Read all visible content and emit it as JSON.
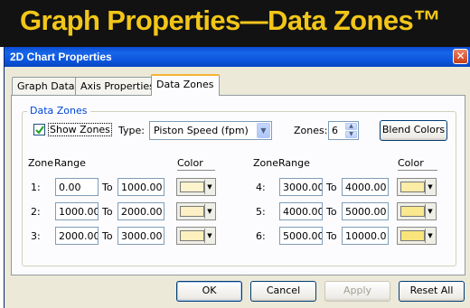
{
  "banner": {
    "title": "Graph Properties—Data Zones™"
  },
  "window": {
    "title": "2D Chart Properties",
    "close_icon": "close-icon"
  },
  "tabs": [
    {
      "label": "Graph Data"
    },
    {
      "label": "Axis Properties"
    },
    {
      "label": "Data Zones",
      "active": true
    }
  ],
  "group": {
    "legend": "Data Zones",
    "show_zones_label": "Show Zones",
    "show_zones_checked": true,
    "type_label": "Type:",
    "type_value": "Piston Speed (fpm)",
    "zones_label": "Zones:",
    "zones_value": "6",
    "blend_colors_label": "Blend Colors"
  },
  "columns": {
    "zone": "Zone",
    "range": "Range",
    "color": "Color",
    "to": "To"
  },
  "zones": [
    {
      "label": "1:",
      "from": "0.00",
      "to": "1000.00",
      "color": "#fdf3cd"
    },
    {
      "label": "2:",
      "from": "1000.00",
      "to": "2000.00",
      "color": "#fdefc6"
    },
    {
      "label": "3:",
      "from": "2000.00",
      "to": "3000.00",
      "color": "#fdf0bd"
    },
    {
      "label": "4:",
      "from": "3000.00",
      "to": "4000.00",
      "color": "#fbeca6"
    },
    {
      "label": "5:",
      "from": "4000.00",
      "to": "5000.00",
      "color": "#f9e88d"
    },
    {
      "label": "6:",
      "from": "5000.00",
      "to": "10000.0",
      "color": "#f8e47a"
    }
  ],
  "buttons": {
    "ok": "OK",
    "cancel": "Cancel",
    "apply": "Apply",
    "reset_all": "Reset All"
  }
}
